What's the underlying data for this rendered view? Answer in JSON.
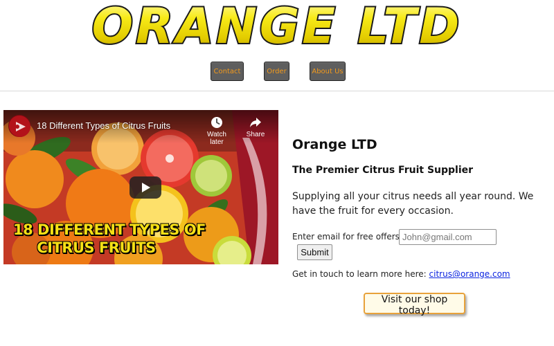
{
  "header": {
    "logo_text": "ORANGE LTD"
  },
  "nav": {
    "items": [
      {
        "label": "Contact"
      },
      {
        "label": "Order"
      },
      {
        "label": "About Us"
      }
    ]
  },
  "video": {
    "title": "18 Different Types of Citrus Fruits",
    "watch_later_label": "Watch later",
    "share_label": "Share",
    "caption_line1": "18 DIFFERENT TYPES OF",
    "caption_line2": "CITRUS FRUITS",
    "play_icon": "play-icon"
  },
  "main": {
    "company_name": "Orange LTD",
    "tagline": "The Premier Citrus Fruit Supplier",
    "description": "Supplying all your citrus needs all year round. We have the fruit for every occasion.",
    "email_label": "Enter email for free offers:",
    "email_placeholder": "John@gmail.com",
    "submit_label": "Submit",
    "contact_text": "Get in touch to learn more here:",
    "contact_email": "citrus@orange.com",
    "shop_button_label": "Visit our shop today!"
  },
  "colors": {
    "nav_button_bg": "#5e5e5e",
    "nav_button_text": "#f39a1c",
    "logo_yellow": "#f1e000",
    "link": "#0b24e0",
    "shop_button_border": "#e8a23a"
  }
}
